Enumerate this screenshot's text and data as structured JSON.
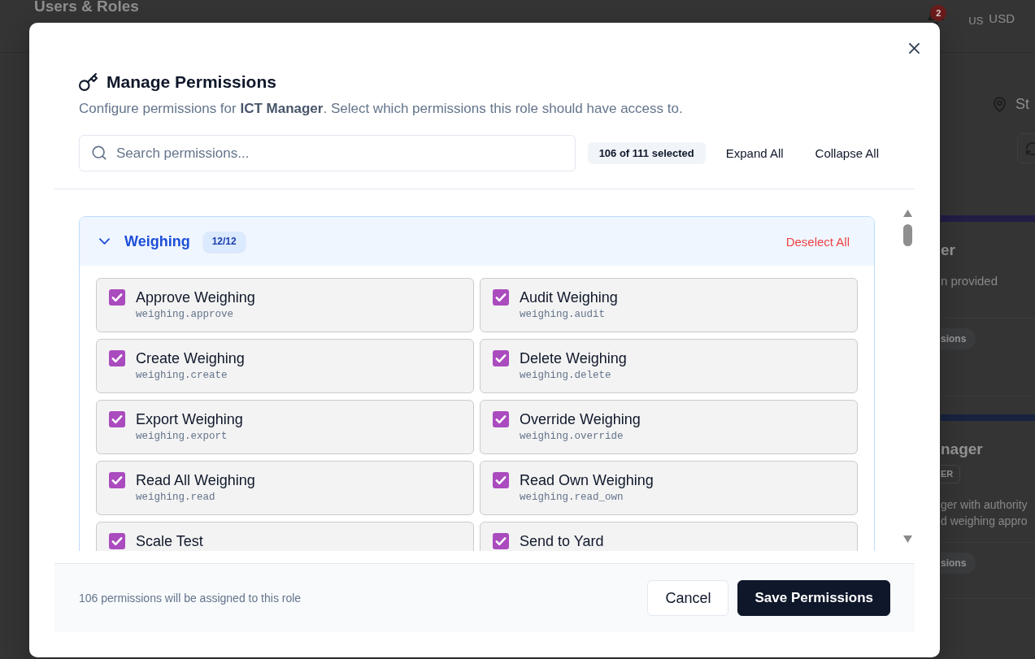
{
  "background_page": {
    "title": "Users & Roles",
    "notification_count": "2",
    "locale": "US",
    "currency": "USD",
    "location": "St",
    "role_cards": [
      {
        "name": "er",
        "description": [
          "n provided"
        ],
        "badge": "sions",
        "color": "#211d45"
      },
      {
        "name": "nager",
        "tag": "ER",
        "description": [
          "ger with authority",
          "d weighing appro"
        ],
        "badge": "sions",
        "color": "#17223f"
      }
    ]
  },
  "dialog": {
    "title": "Manage Permissions",
    "description": "Configure permissions for **ICT Manager**. Select which permissions this role should have access to.",
    "search": {
      "placeholder": "Search permissions..."
    },
    "selection_count": "106 of 111 selected",
    "actions": [
      "Expand All",
      "Collapse All"
    ],
    "groups": [
      {
        "name": "Weighing",
        "count": "12/12",
        "expanded": true,
        "action": "Deselect All",
        "permissions": [
          {
            "label": "Approve Weighing",
            "code": "weighing.approve",
            "checked": true
          },
          {
            "label": "Audit Weighing",
            "code": "weighing.audit",
            "checked": true
          },
          {
            "label": "Create Weighing",
            "code": "weighing.create",
            "checked": true
          },
          {
            "label": "Delete Weighing",
            "code": "weighing.delete",
            "checked": true
          },
          {
            "label": "Export Weighing",
            "code": "weighing.export",
            "checked": true
          },
          {
            "label": "Override Weighing",
            "code": "weighing.override",
            "checked": true
          },
          {
            "label": "Read All Weighing",
            "code": "weighing.read",
            "checked": true
          },
          {
            "label": "Read Own Weighing",
            "code": "weighing.read_own",
            "checked": true
          },
          {
            "label": "Scale Test",
            "checked": true
          },
          {
            "label": "Send to Yard",
            "checked": true
          }
        ]
      }
    ],
    "footer_note": "106 permissions will be assigned to this role",
    "buttons": [
      {
        "label": "Cancel",
        "kind": "cancel"
      },
      {
        "label": "Save Permissions",
        "kind": "submit"
      }
    ]
  }
}
